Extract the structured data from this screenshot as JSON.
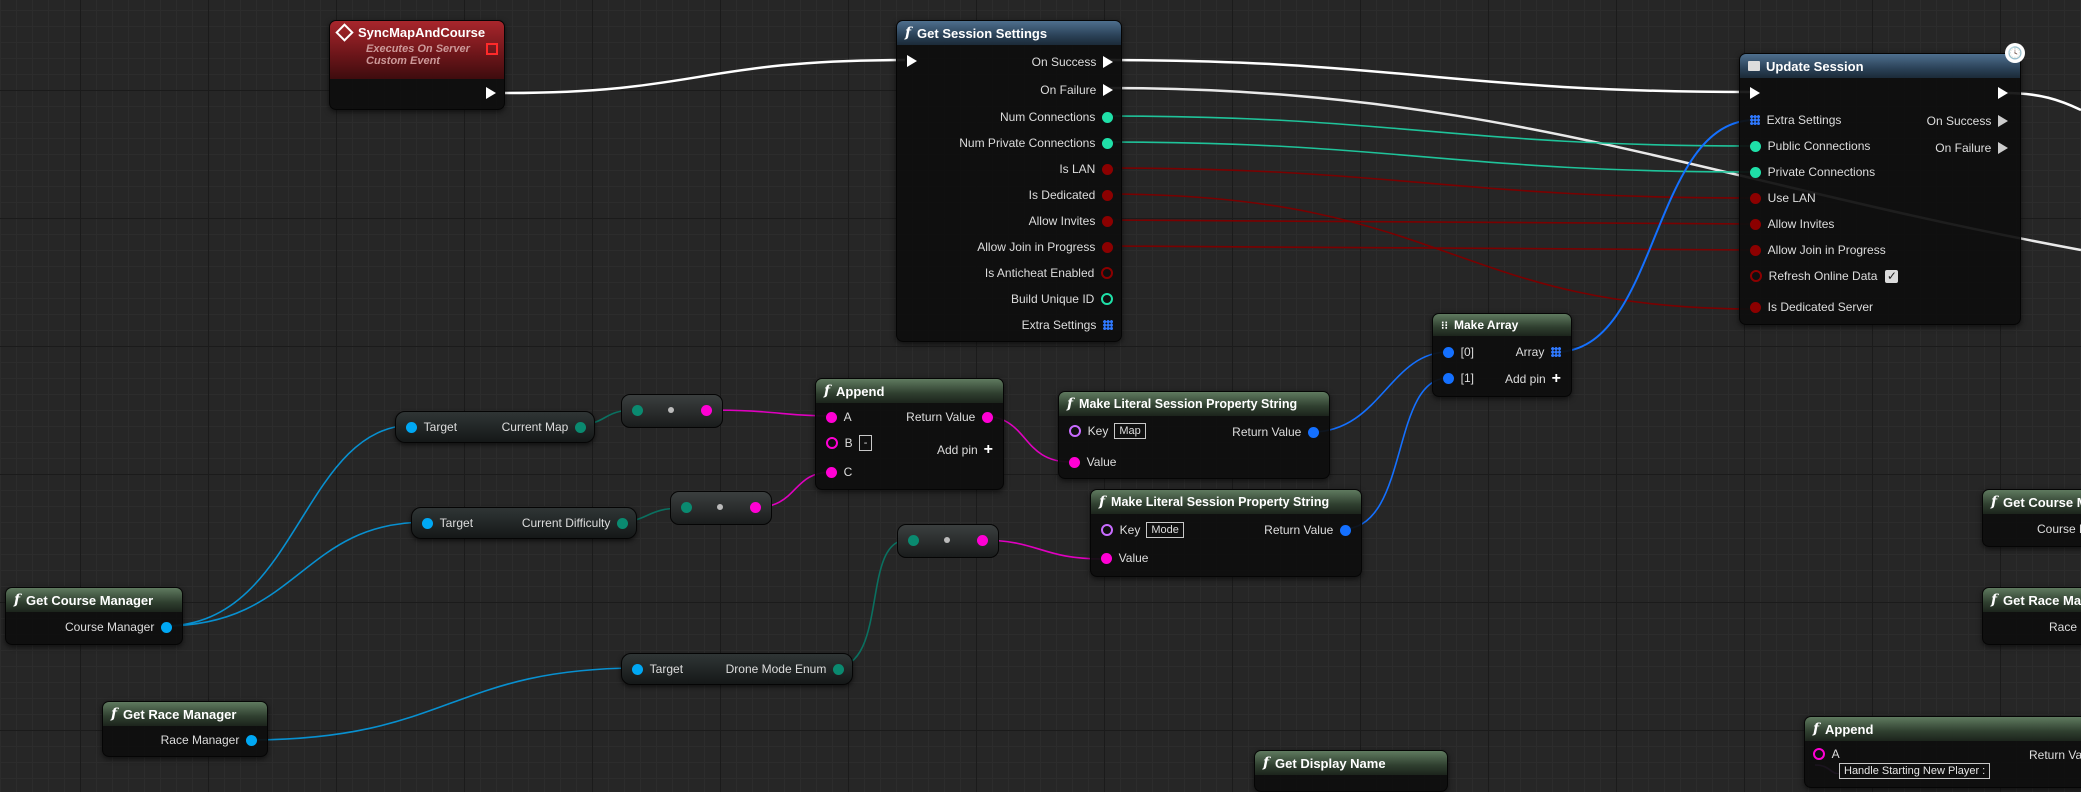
{
  "colors": {
    "exec": "#ffffff",
    "bool": "#8c0000",
    "int": "#1fe0a8",
    "string": "#ff00d4",
    "struct": "#1470ff",
    "object": "#00a8f4",
    "name": "#c86bff"
  },
  "nodes": {
    "sync_event": {
      "title": "SyncMapAndCourse",
      "subtitle1": "Executes On Server",
      "subtitle2": "Custom Event"
    },
    "get_session_settings": {
      "title": "Get Session Settings",
      "pins": [
        "On Success",
        "On Failure",
        "Num Connections",
        "Num Private Connections",
        "Is LAN",
        "Is Dedicated",
        "Allow Invites",
        "Allow Join in Progress",
        "Is Anticheat Enabled",
        "Build Unique ID",
        "Extra Settings"
      ]
    },
    "update_session": {
      "title": "Update Session",
      "inputs": [
        "Extra Settings",
        "Public Connections",
        "Private Connections",
        "Use LAN",
        "Allow Invites",
        "Allow Join in Progress",
        "Refresh Online Data",
        "Is Dedicated Server"
      ],
      "outputs": [
        "On Success",
        "On Failure"
      ]
    },
    "make_array": {
      "title": "Make Array",
      "in0": "[0]",
      "in1": "[1]",
      "out": "Array",
      "add_pin": "Add pin"
    },
    "append": {
      "title": "Append",
      "a": "A",
      "b": "B",
      "b_value": "-",
      "c": "C",
      "ret": "Return Value",
      "add_pin": "Add pin"
    },
    "make_literal_1": {
      "title": "Make Literal Session Property String",
      "key": "Key",
      "key_value": "Map",
      "value": "Value",
      "ret": "Return Value"
    },
    "make_literal_2": {
      "title": "Make Literal Session Property String",
      "key": "Key",
      "key_value": "Mode",
      "value": "Value",
      "ret": "Return Value"
    },
    "current_map": {
      "target": "Target",
      "out": "Current Map"
    },
    "current_difficulty": {
      "target": "Target",
      "out": "Current Difficulty"
    },
    "drone_mode": {
      "target": "Target",
      "out": "Drone Mode Enum"
    },
    "get_course_manager": {
      "title": "Get Course Manager",
      "out": "Course Manager"
    },
    "get_race_manager": {
      "title": "Get Race Manager",
      "out": "Race Manager"
    },
    "get_course_partial": {
      "title": "Get Course M",
      "out": "Course M"
    },
    "get_race_partial": {
      "title": "Get Race Ma",
      "out": "Race Ma"
    },
    "append_2": {
      "title": "Append",
      "a": "A",
      "a_value": "Handle Starting New Player :",
      "ret": "Return Va"
    },
    "get_display_name": {
      "title": "Get Display Name"
    }
  }
}
